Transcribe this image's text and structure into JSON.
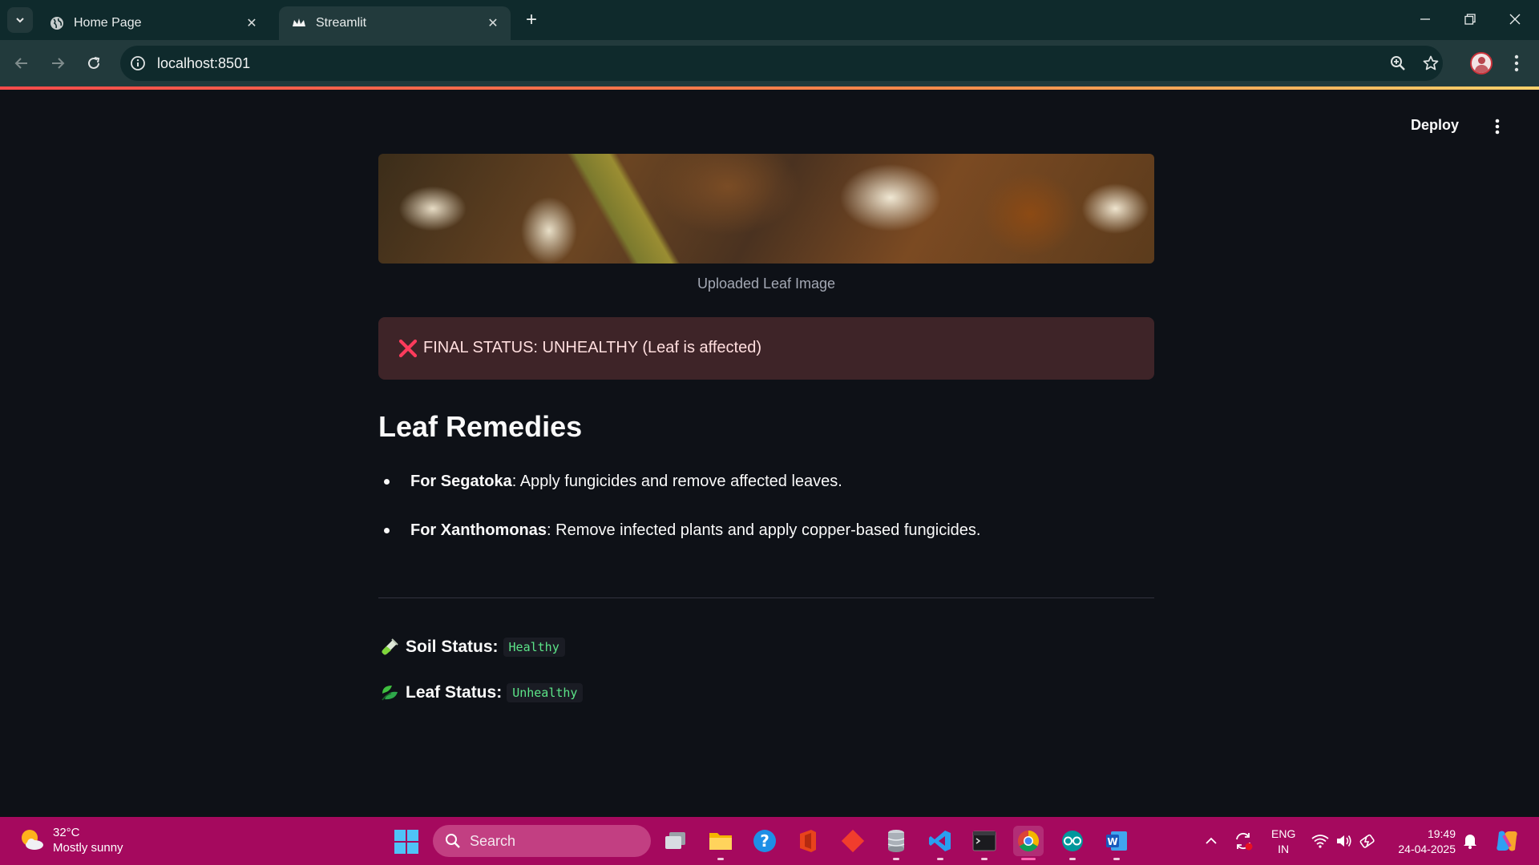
{
  "browser": {
    "tabs": [
      {
        "title": "Home Page",
        "icon": "globe-icon"
      },
      {
        "title": "Streamlit",
        "icon": "streamlit-crown-icon"
      }
    ],
    "active_tab": 1,
    "url": "localhost:8501"
  },
  "app": {
    "header": {
      "deploy_label": "Deploy"
    },
    "image_caption": "Uploaded Leaf Image",
    "alert": {
      "text": "FINAL STATUS: UNHEALTHY (Leaf is affected)",
      "icon": "red-x-icon"
    },
    "remedies_heading": "Leaf Remedies",
    "remedies": [
      {
        "label": "For Segatoka",
        "text": ": Apply fungicides and remove affected leaves."
      },
      {
        "label": "For Xanthomonas",
        "text": ": Remove infected plants and apply copper-based fungicides."
      }
    ],
    "soil_status": {
      "label": "Soil Status:",
      "value": "Healthy",
      "icon": "test-tube-icon"
    },
    "leaf_status": {
      "label": "Leaf Status:",
      "value": "Unhealthy",
      "icon": "leaf-icon"
    }
  },
  "taskbar": {
    "weather": {
      "temp": "32°C",
      "desc": "Mostly sunny"
    },
    "search_placeholder": "Search",
    "lang": {
      "line1": "ENG",
      "line2": "IN"
    },
    "clock": {
      "time": "19:49",
      "date": "24-04-2025"
    }
  },
  "colors": {
    "app_bg": "#0e1117",
    "alert_bg": "#3e2428",
    "code_green": "#5ce488",
    "taskbar": "#a5095e",
    "browser_chrome": "#0f2a2c"
  }
}
